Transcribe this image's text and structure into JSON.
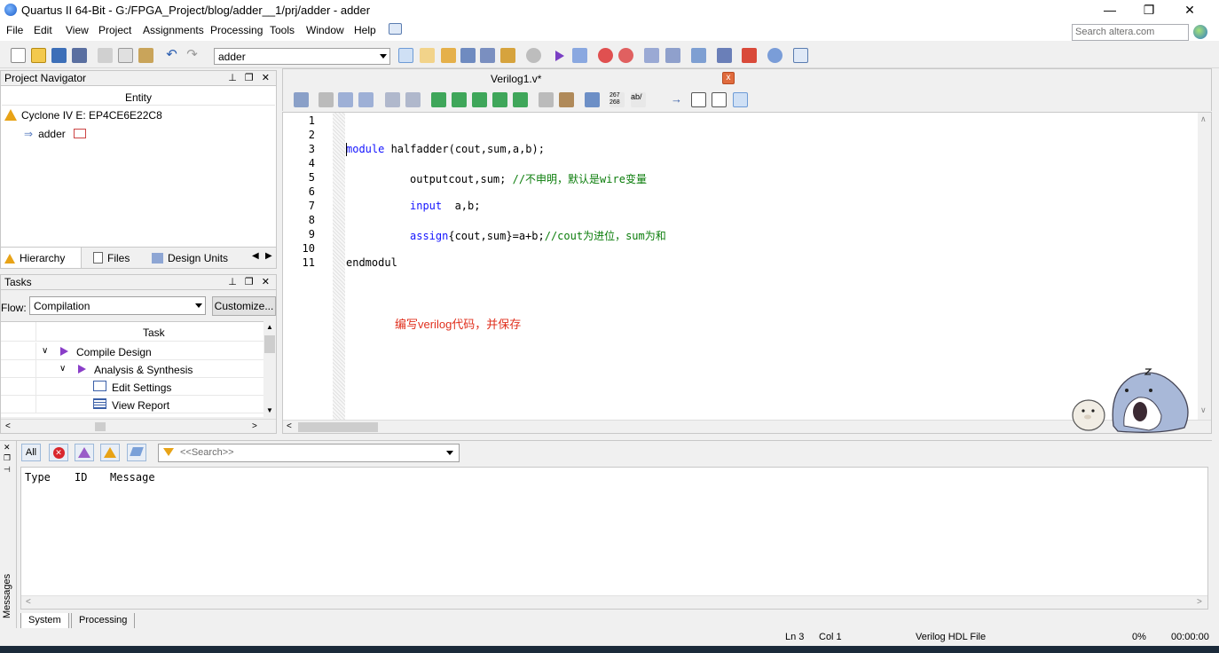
{
  "window": {
    "title": "Quartus II 64-Bit - G:/FPGA_Project/blog/adder__1/prj/adder - adder",
    "minimize_glyph": "—",
    "maximize_glyph": "❐",
    "close_glyph": "✕"
  },
  "menu": {
    "items": [
      "File",
      "Edit",
      "View",
      "Project",
      "Assignments",
      "Processing",
      "Tools",
      "Window",
      "Help"
    ],
    "search_placeholder": "Search altera.com"
  },
  "toolbar": {
    "entity_combo_value": "adder",
    "icons": [
      "new-file-icon",
      "open-icon",
      "save-icon",
      "save-all-icon",
      "cut-icon",
      "copy-icon",
      "paste-icon",
      "undo-icon",
      "redo-icon",
      "chip-planner-icon",
      "pin-planner-icon",
      "settings-icon",
      "netlist-icon",
      "stop-icon",
      "start-compile-icon",
      "analysis-icon",
      "timing-icon",
      "timing-analyzer-icon",
      "rtl-viewer-icon",
      "tech-map-icon",
      "programmer-icon",
      "signal-tap-icon",
      "help-icon",
      "comment-icon"
    ]
  },
  "project_navigator": {
    "title": "Project Navigator",
    "column_header": "Entity",
    "device": "Cyclone IV E: EP4CE6E22C8",
    "top_entity": "adder",
    "tabs": [
      "Hierarchy",
      "Files",
      "Design Units"
    ]
  },
  "tasks": {
    "title": "Tasks",
    "flow_label": "Flow:",
    "flow_value": "Compilation",
    "customize_label": "Customize...",
    "column_header": "Task",
    "rows": [
      {
        "label": "Compile Design",
        "level": 0
      },
      {
        "label": "Analysis & Synthesis",
        "level": 1
      },
      {
        "label": "Edit Settings",
        "level": 2
      },
      {
        "label": "View Report",
        "level": 2
      }
    ]
  },
  "editor": {
    "tab_label": "Verilog1.v*",
    "close_glyph": "x",
    "line_numbers": [
      "1",
      "2",
      "3",
      "4",
      "5",
      "6",
      "7",
      "8",
      "9",
      "10",
      "11"
    ],
    "lines": {
      "l3_kw": "module",
      "l3_rest": " halfadder(cout,sum,a,b);",
      "l5_code": "outputcout,sum; ",
      "l5_comment": "//不申明，默认是wire变量",
      "l7_kw": "input",
      "l7_rest": "  a,b;",
      "l9_kw": "assign",
      "l9_code": "{cout,sum}=a+b;",
      "l9_comment": "//cout为进位，sum为和",
      "l11_code": "endmodul"
    },
    "annotation": "编写verilog代码，并保存"
  },
  "messages": {
    "side_label": "Messages",
    "filter_all": "All",
    "search_placeholder": "<<Search>>",
    "columns": [
      "Type",
      "ID",
      "Message"
    ],
    "tabs": [
      "System",
      "Processing"
    ]
  },
  "status": {
    "line": "Ln 3",
    "col": "Col 1",
    "file_type": "Verilog HDL File",
    "progress": "0%",
    "time": "00:00:00"
  },
  "colors": {
    "keyword": "#1414ff",
    "comment": "#0b7d0b",
    "annotation": "#e0301e",
    "warning": "#e8a317",
    "play": "#8a3ec8"
  }
}
